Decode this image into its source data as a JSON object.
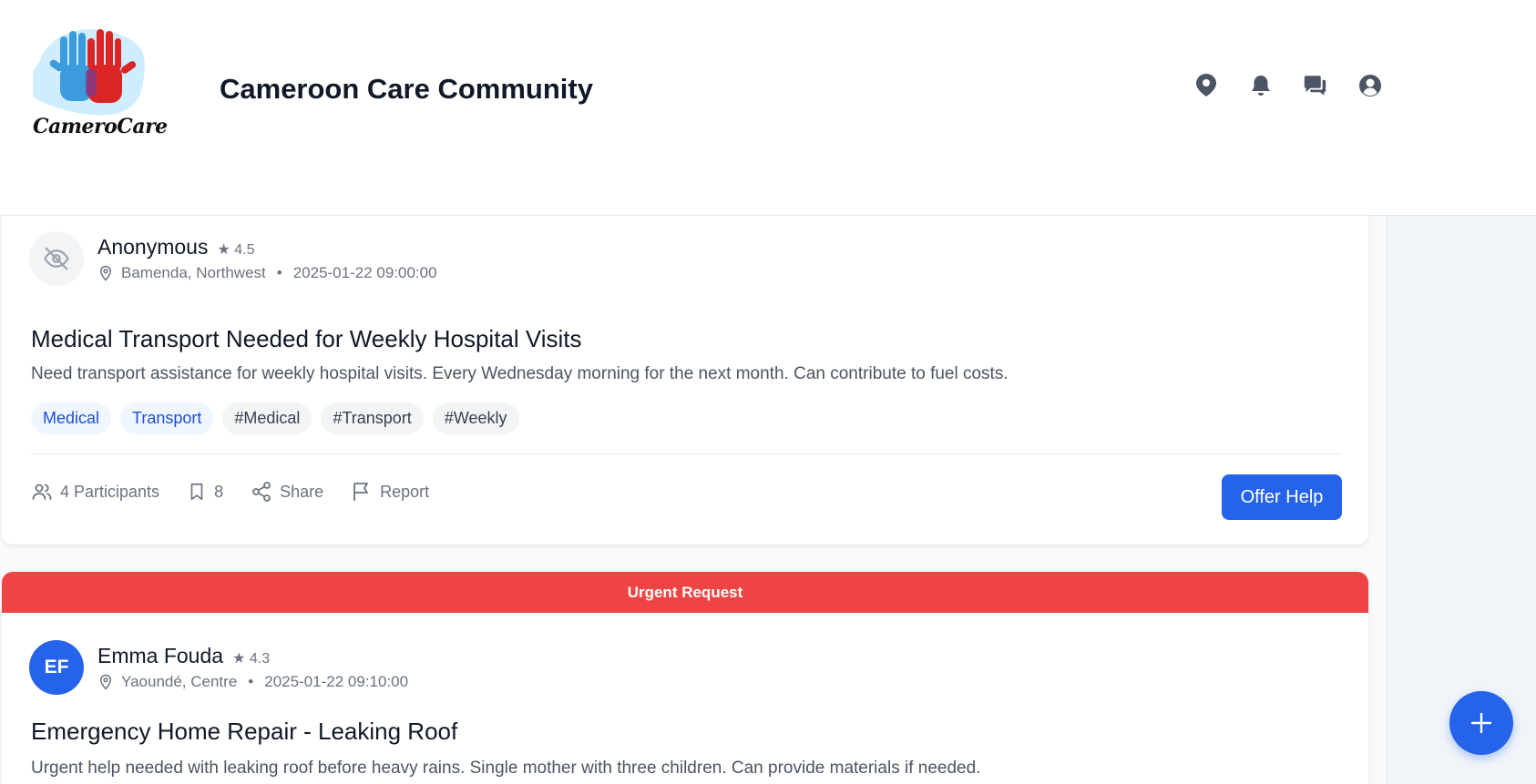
{
  "header": {
    "logo_text": "CameroCare",
    "title": "Cameroon Care Community",
    "icons": [
      "location-icon",
      "bell-icon",
      "chat-icon",
      "user-icon"
    ]
  },
  "posts": [
    {
      "author": "Anonymous",
      "rating": "4.5",
      "location": "Bamenda, Northwest",
      "timestamp": "2025-01-22 09:00:00",
      "title": "Medical Transport Needed for Weekly Hospital Visits",
      "description": "Need transport assistance for weekly hospital visits. Every Wednesday morning for the next month. Can contribute to fuel costs.",
      "categories": [
        "Medical",
        "Transport"
      ],
      "hashtags": [
        "#Medical",
        "#Transport",
        "#Weekly"
      ],
      "participants": "4 Participants",
      "bookmarks": "8",
      "share": "Share",
      "report": "Report",
      "offer_help": "Offer Help",
      "accent_color": "#ef4444"
    },
    {
      "banner": "Urgent Request",
      "author": "Emma Fouda",
      "initials": "EF",
      "rating": "4.3",
      "location": "Yaoundé, Centre",
      "timestamp": "2025-01-22 09:10:00",
      "title": "Emergency Home Repair - Leaking Roof",
      "description": "Urgent help needed with leaking roof before heavy rains. Single mother with three children. Can provide materials if needed.",
      "accent_color": "#ef4444"
    }
  ],
  "fab": {
    "icon": "plus-icon"
  },
  "colors": {
    "primary": "#2563eb",
    "urgent": "#ef4444"
  }
}
